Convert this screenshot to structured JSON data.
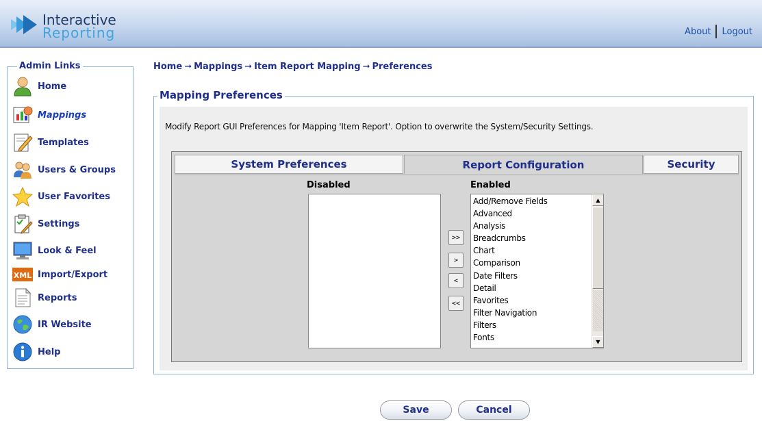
{
  "app": {
    "logo_line1": "Interactive",
    "logo_line2": "Reporting"
  },
  "header": {
    "about": "About",
    "logout": "Logout"
  },
  "sidebar": {
    "title": "Admin Links",
    "items": [
      {
        "label": "Home",
        "icon": "user-icon"
      },
      {
        "label": "Mappings",
        "icon": "mappings-chart-icon",
        "active": true
      },
      {
        "label": "Templates",
        "icon": "template-pencil-icon"
      },
      {
        "label": "Users & Groups",
        "icon": "users-icon"
      },
      {
        "label": "User Favorites",
        "icon": "star-icon"
      },
      {
        "label": "Settings",
        "icon": "settings-clipboard-icon"
      },
      {
        "label": "Look & Feel",
        "icon": "monitor-icon"
      },
      {
        "label": "Import/Export",
        "icon": "xml-icon"
      },
      {
        "label": "Reports",
        "icon": "document-icon"
      },
      {
        "label": "IR Website",
        "icon": "globe-icon"
      },
      {
        "label": "Help",
        "icon": "info-icon"
      }
    ]
  },
  "breadcrumb": {
    "items": [
      "Home",
      "Mappings",
      "Item Report Mapping",
      "Preferences"
    ],
    "separator": "➞"
  },
  "main": {
    "title": "Mapping Preferences",
    "description": "Modify Report GUI Preferences for Mapping 'Item Report'. Option to overwrite the System/Security Settings.",
    "tabs": [
      {
        "label": "System Preferences"
      },
      {
        "label": "Report Configuration",
        "active": true
      },
      {
        "label": "Security"
      }
    ],
    "disabled_label": "Disabled",
    "enabled_label": "Enabled",
    "disabled_items": [],
    "enabled_items": [
      "Add/Remove Fields",
      "Advanced",
      "Analysis",
      "Breadcrumbs",
      "Chart",
      "Comparison",
      "Date Filters",
      "Detail",
      "Favorites",
      "Filter Navigation",
      "Filters",
      "Fonts"
    ],
    "move_buttons": {
      "add_all": ">>",
      "add": ">",
      "remove": "<",
      "remove_all": "<<"
    }
  },
  "actions": {
    "save": "Save",
    "cancel": "Cancel"
  },
  "colors": {
    "accent": "#1f2f8a",
    "border": "#8fb3dc",
    "header_top": "#e9f0f9",
    "header_bottom": "#a6bfe1"
  }
}
